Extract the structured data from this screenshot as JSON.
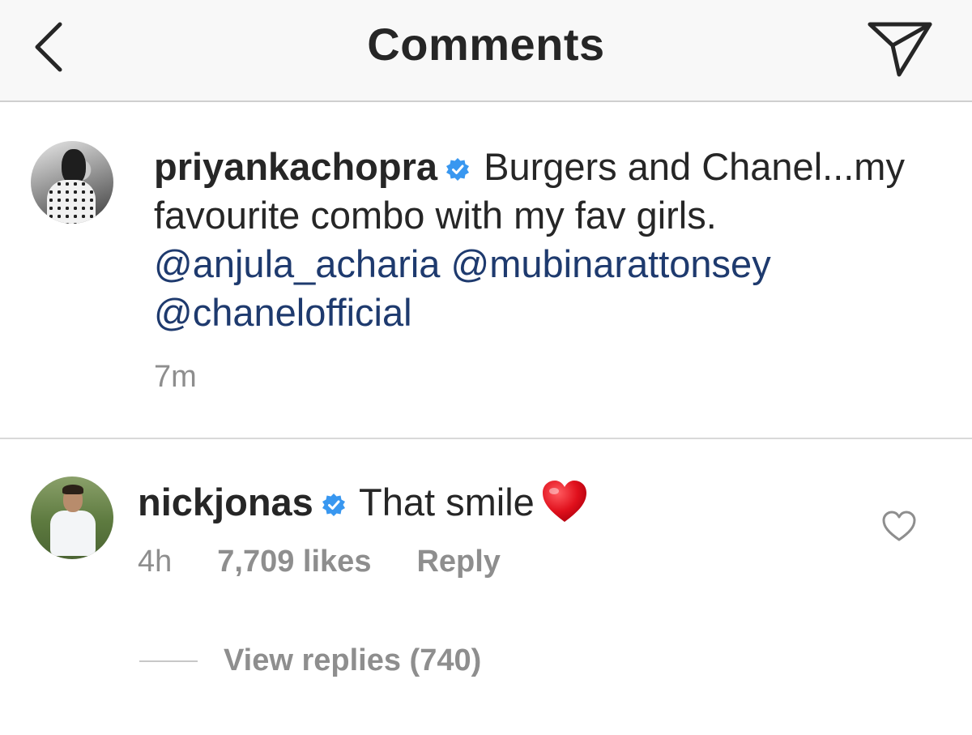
{
  "header": {
    "title": "Comments",
    "back_icon": "chevron-left-icon",
    "share_icon": "paper-plane-icon"
  },
  "caption": {
    "username": "priyankachopra",
    "verified": true,
    "text": "Burgers and Chanel...my favourite combo with my fav girls.",
    "mentions": [
      "@anjula_acharia",
      "@mubinarattonsey",
      "@chanelofficial"
    ],
    "time": "7m"
  },
  "comment": {
    "username": "nickjonas",
    "verified": true,
    "text": "That smile",
    "emoji": "red-heart",
    "time": "4h",
    "likes": "7,709 likes",
    "reply_label": "Reply",
    "view_replies_label": "View replies (740)"
  },
  "colors": {
    "verified_badge": "#3897f0",
    "mention": "#1e3a6e",
    "muted_text": "#8e8e8e",
    "heart": "#e0101c"
  }
}
